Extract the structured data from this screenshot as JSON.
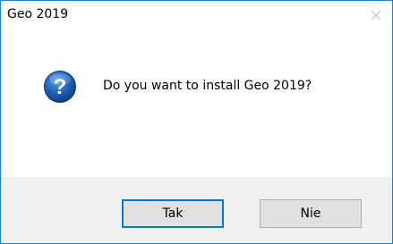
{
  "window": {
    "title": "Geo 2019",
    "close_icon": "close-icon"
  },
  "content": {
    "icon": "question-icon",
    "message": "Do you want to install Geo 2019?"
  },
  "buttons": {
    "yes_label": "Tak",
    "no_label": "Nie"
  },
  "colors": {
    "border": "#1883d7",
    "icon_blue": "#1a5fb4",
    "footer_bg": "#f0f0f0",
    "button_bg": "#e1e1e1",
    "default_button_border": "#0078d7"
  }
}
